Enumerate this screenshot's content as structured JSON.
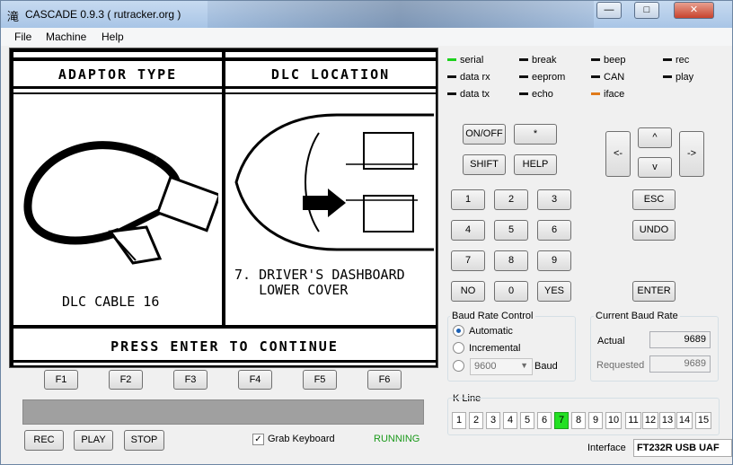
{
  "window": {
    "title": "CASCADE 0.9.3 ( rutracker.org )",
    "app_icon": "滝"
  },
  "window_controls": {
    "minimize": "—",
    "maximize": "□",
    "close": "✕"
  },
  "menu": [
    "File",
    "Machine",
    "Help"
  ],
  "screen": {
    "left_header": "ADAPTOR TYPE",
    "right_header": "DLC LOCATION",
    "left_caption": "DLC CABLE 16",
    "right_caption": "7. DRIVER'S DASHBOARD\n   LOWER COVER",
    "footer": "PRESS ENTER TO CONTINUE"
  },
  "function_keys": [
    "F1",
    "F2",
    "F3",
    "F4",
    "F5",
    "F6"
  ],
  "bottom_buttons": {
    "rec": "REC",
    "play": "PLAY",
    "stop": "STOP"
  },
  "grab_keyboard": {
    "label": "Grab Keyboard",
    "checked": true,
    "mark": "✓"
  },
  "status": "RUNNING",
  "indicators": [
    {
      "label": "serial",
      "color": "#1dd11d"
    },
    {
      "label": "break",
      "color": "#111111"
    },
    {
      "label": "beep",
      "color": "#111111"
    },
    {
      "label": "rec",
      "color": "#111111"
    },
    {
      "label": "data rx",
      "color": "#111111"
    },
    {
      "label": "eeprom",
      "color": "#111111"
    },
    {
      "label": "CAN",
      "color": "#111111"
    },
    {
      "label": "play",
      "color": "#111111"
    },
    {
      "label": "data tx",
      "color": "#111111"
    },
    {
      "label": "echo",
      "color": "#111111"
    },
    {
      "label": "iface",
      "color": "#e07a1a"
    }
  ],
  "keypad": {
    "onoff": "ON/OFF",
    "star": "*",
    "shift": "SHIFT",
    "help": "HELP",
    "digits": [
      "1",
      "2",
      "3",
      "4",
      "5",
      "6",
      "7",
      "8",
      "9",
      "0"
    ],
    "no": "NO",
    "yes": "YES",
    "left": "<-",
    "up": "^",
    "down": "v",
    "right": "->",
    "esc": "ESC",
    "undo": "UNDO",
    "enter": "ENTER"
  },
  "baud_control": {
    "title": "Baud Rate Control",
    "automatic": "Automatic",
    "incremental": "Incremental",
    "selected_baud": "9600",
    "baud_label": "Baud",
    "mode": "Automatic"
  },
  "current_baud": {
    "title": "Current Baud Rate",
    "actual_label": "Actual",
    "actual_value": "9689",
    "requested_label": "Requested",
    "requested_value": "9689"
  },
  "kline": {
    "title": "K Line",
    "cells": [
      "1",
      "2",
      "3",
      "4",
      "5",
      "6",
      "7",
      "8",
      "9",
      "10",
      "11",
      "12",
      "13",
      "14",
      "15"
    ],
    "active": "7"
  },
  "interface": {
    "label": "Interface",
    "value": "FT232R USB UAF"
  }
}
